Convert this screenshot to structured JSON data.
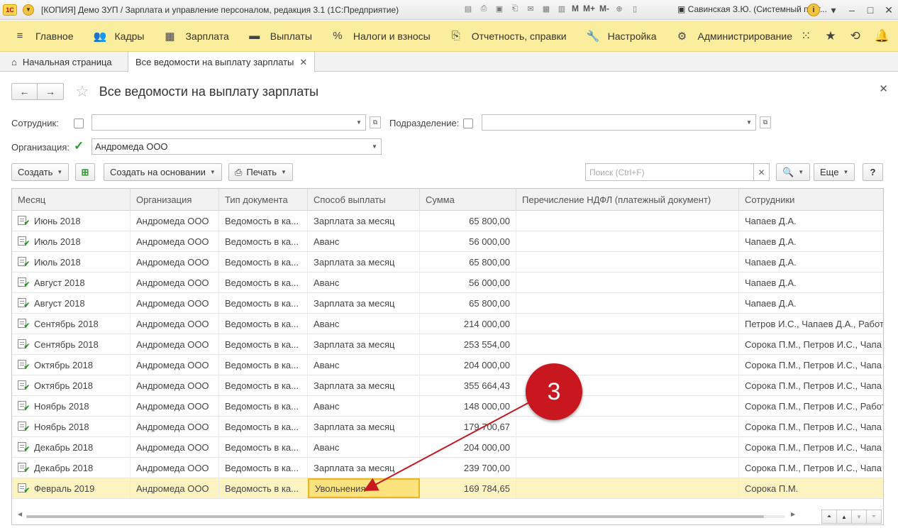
{
  "app": {
    "title": "[КОПИЯ] Демо ЗУП / Зарплата и управление персоналом, редакция 3.1  (1С:Предприятие)",
    "logo_text": "1С",
    "toolbar_icons": [
      "save-icon",
      "print-icon",
      "preview-icon",
      "clip-icon",
      "mail-icon",
      "calc-icon",
      "calendar-icon"
    ],
    "memory_buttons": [
      "M",
      "M+",
      "M-"
    ],
    "user": "Савинская З.Ю. (Системный прог..."
  },
  "menu": {
    "items": [
      {
        "label": "Главное",
        "icon": "≡"
      },
      {
        "label": "Кадры",
        "icon": "👥"
      },
      {
        "label": "Зарплата",
        "icon": "▦"
      },
      {
        "label": "Выплаты",
        "icon": "▬"
      },
      {
        "label": "Налоги и взносы",
        "icon": "%"
      },
      {
        "label": "Отчетность, справки",
        "icon": "⎘"
      },
      {
        "label": "Настройка",
        "icon": "🔧"
      },
      {
        "label": "Администрирование",
        "icon": "⚙"
      }
    ]
  },
  "tabs": {
    "home": "Начальная страница",
    "active": "Все ведомости на выплату зарплаты"
  },
  "form": {
    "title": "Все ведомости на выплату зарплаты",
    "employee_label": "Сотрудник:",
    "employee_value": "",
    "department_label": "Подразделение:",
    "department_value": "",
    "organization_label": "Организация:",
    "organization_value": "Андромеда ООО",
    "organization_checked": true
  },
  "commands": {
    "create": "Создать",
    "create_based": "Создать на основании",
    "print": "Печать",
    "search_placeholder": "Поиск (Ctrl+F)",
    "more": "Еще",
    "help": "?"
  },
  "table": {
    "columns": [
      "Месяц",
      "Организация",
      "Тип документа",
      "Способ выплаты",
      "Сумма",
      "Перечисление НДФЛ (платежный документ)",
      "Сотрудники"
    ],
    "rows": [
      {
        "month": "Июнь 2018",
        "org": "Андромеда ООО",
        "doctype": "Ведомость в ка...",
        "method": "Зарплата за месяц",
        "sum": "65 800,00",
        "ndfl": "",
        "employees": "Чапаев Д.А."
      },
      {
        "month": "Июль 2018",
        "org": "Андромеда ООО",
        "doctype": "Ведомость в ка...",
        "method": "Аванс",
        "sum": "56 000,00",
        "ndfl": "",
        "employees": "Чапаев Д.А."
      },
      {
        "month": "Июль 2018",
        "org": "Андромеда ООО",
        "doctype": "Ведомость в ка...",
        "method": "Зарплата за месяц",
        "sum": "65 800,00",
        "ndfl": "",
        "employees": "Чапаев Д.А."
      },
      {
        "month": "Август 2018",
        "org": "Андромеда ООО",
        "doctype": "Ведомость в ка...",
        "method": "Аванс",
        "sum": "56 000,00",
        "ndfl": "",
        "employees": "Чапаев Д.А."
      },
      {
        "month": "Август 2018",
        "org": "Андромеда ООО",
        "doctype": "Ведомость в ка...",
        "method": "Зарплата за месяц",
        "sum": "65 800,00",
        "ndfl": "",
        "employees": "Чапаев Д.А."
      },
      {
        "month": "Сентябрь 2018",
        "org": "Андромеда ООО",
        "doctype": "Ведомость в ка...",
        "method": "Аванс",
        "sum": "214 000,00",
        "ndfl": "",
        "employees": "Петров И.С., Чапаев Д.А., Работ"
      },
      {
        "month": "Сентябрь 2018",
        "org": "Андромеда ООО",
        "doctype": "Ведомость в ка...",
        "method": "Зарплата за месяц",
        "sum": "253 554,00",
        "ndfl": "",
        "employees": "Сорока П.М., Петров И.С., Чапа"
      },
      {
        "month": "Октябрь 2018",
        "org": "Андромеда ООО",
        "doctype": "Ведомость в ка...",
        "method": "Аванс",
        "sum": "204 000,00",
        "ndfl": "",
        "employees": "Сорока П.М., Петров И.С., Чапа"
      },
      {
        "month": "Октябрь 2018",
        "org": "Андромеда ООО",
        "doctype": "Ведомость в ка...",
        "method": "Зарплата за месяц",
        "sum": "355 664,43",
        "ndfl": "",
        "employees": "Сорока П.М., Петров И.С., Чапа"
      },
      {
        "month": "Ноябрь 2018",
        "org": "Андромеда ООО",
        "doctype": "Ведомость в ка...",
        "method": "Аванс",
        "sum": "148 000,00",
        "ndfl": "",
        "employees": "Сорока П.М., Петров И.С., Работ"
      },
      {
        "month": "Ноябрь 2018",
        "org": "Андромеда ООО",
        "doctype": "Ведомость в ка...",
        "method": "Зарплата за месяц",
        "sum": "179 700,67",
        "ndfl": "",
        "employees": "Сорока П.М., Петров И.С., Чапа"
      },
      {
        "month": "Декабрь 2018",
        "org": "Андромеда ООО",
        "doctype": "Ведомость в ка...",
        "method": "Аванс",
        "sum": "204 000,00",
        "ndfl": "",
        "employees": "Сорока П.М., Петров И.С., Чапа"
      },
      {
        "month": "Декабрь 2018",
        "org": "Андромеда ООО",
        "doctype": "Ведомость в ка...",
        "method": "Зарплата за месяц",
        "sum": "239 700,00",
        "ndfl": "",
        "employees": "Сорока П.М., Петров И.С., Чапа"
      },
      {
        "month": "Февраль 2019",
        "org": "Андромеда ООО",
        "doctype": "Ведомость в ка...",
        "method": "Увольнения",
        "sum": "169 784,65",
        "ndfl": "",
        "employees": "Сорока П.М.",
        "selected": true
      }
    ]
  },
  "annotation": {
    "badge_number": "3",
    "badge_color": "#c8171e"
  },
  "colors": {
    "menu_bg": "#fbed9e",
    "selected_row": "#fdf4c2",
    "highlight_cell": "#fbe27c",
    "check_green": "#2b9a2b"
  }
}
